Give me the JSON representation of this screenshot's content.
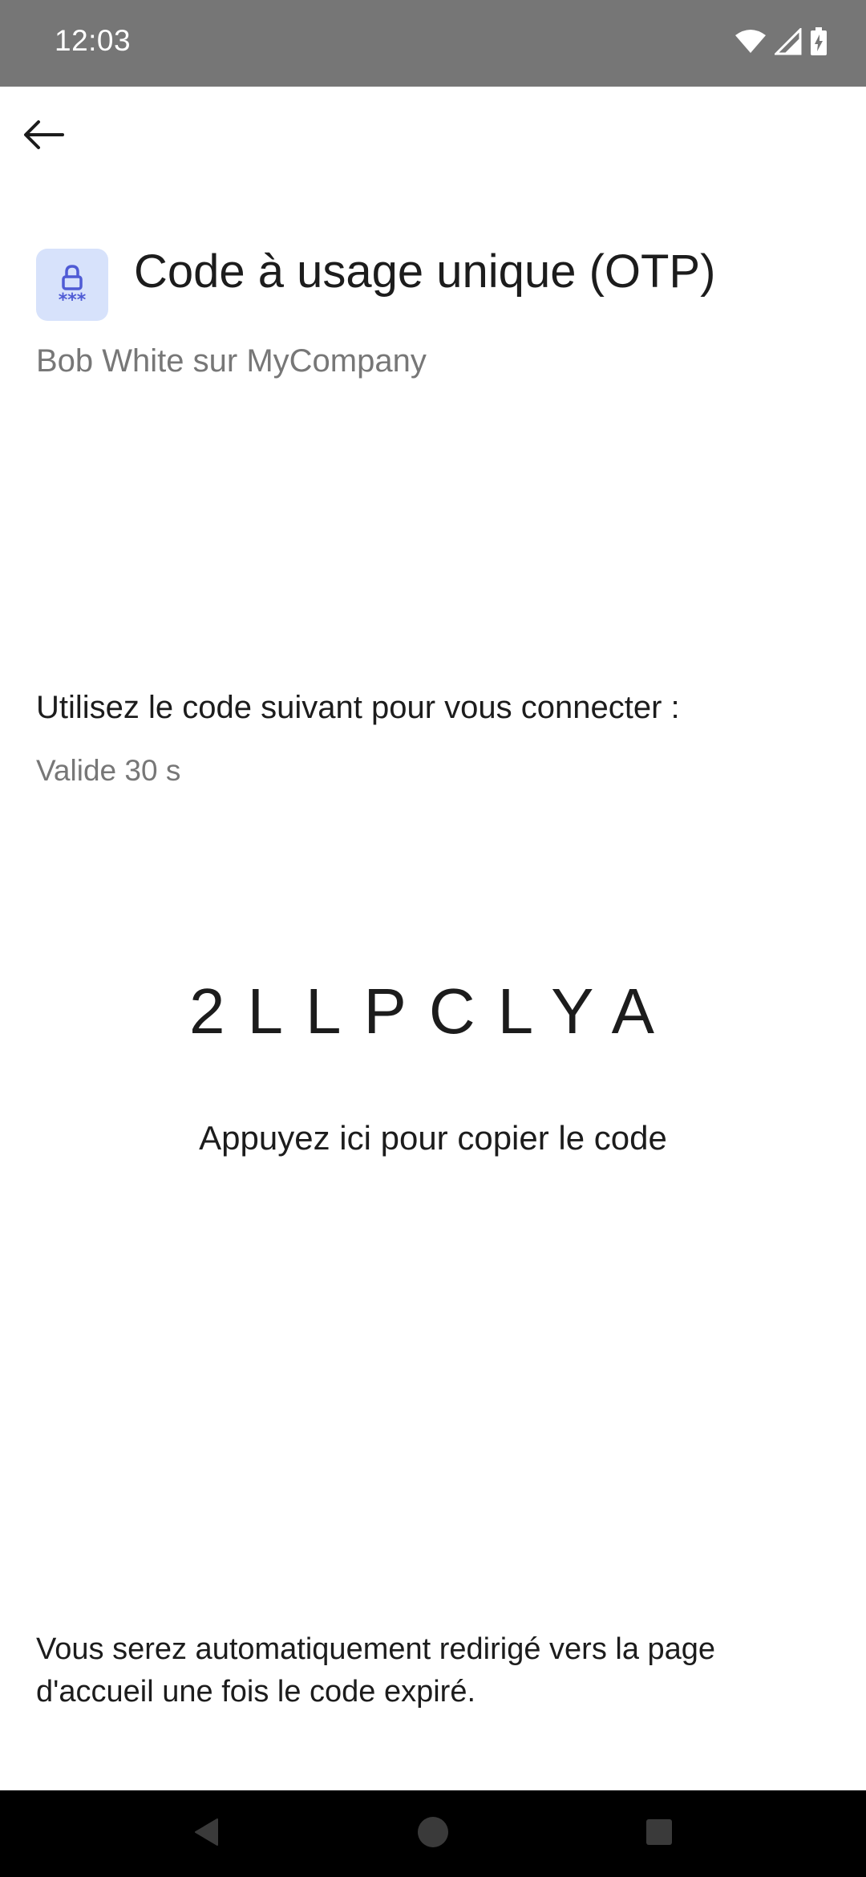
{
  "status_bar": {
    "time": "12:03",
    "icons": [
      "wifi-icon",
      "cellular-signal-icon",
      "battery-charging-icon"
    ]
  },
  "app_bar": {
    "back_icon": "arrow-left-icon"
  },
  "header": {
    "icon": "lock-password-icon",
    "title": "Code à usage unique (OTP)",
    "subtitle": "Bob White sur MyCompany"
  },
  "instructions": {
    "text": "Utilisez le code suivant pour vous connecter :",
    "validity": "Valide 30 s"
  },
  "otp": {
    "code": "2LLPCLYA",
    "copy_hint": "Appuyez ici pour copier le code"
  },
  "footer": {
    "note": "Vous serez automatiquement redirigé vers la page d'accueil une fois le code expiré."
  },
  "nav_bar": {
    "icons": [
      "nav-back-icon",
      "nav-home-icon",
      "nav-recents-icon"
    ]
  },
  "colors": {
    "status_bar_bg": "#767676",
    "icon_bg": "#d7e2fb",
    "icon_accent": "#4f5bd5",
    "secondary_text": "#777777",
    "nav_bar_bg": "#000000"
  }
}
